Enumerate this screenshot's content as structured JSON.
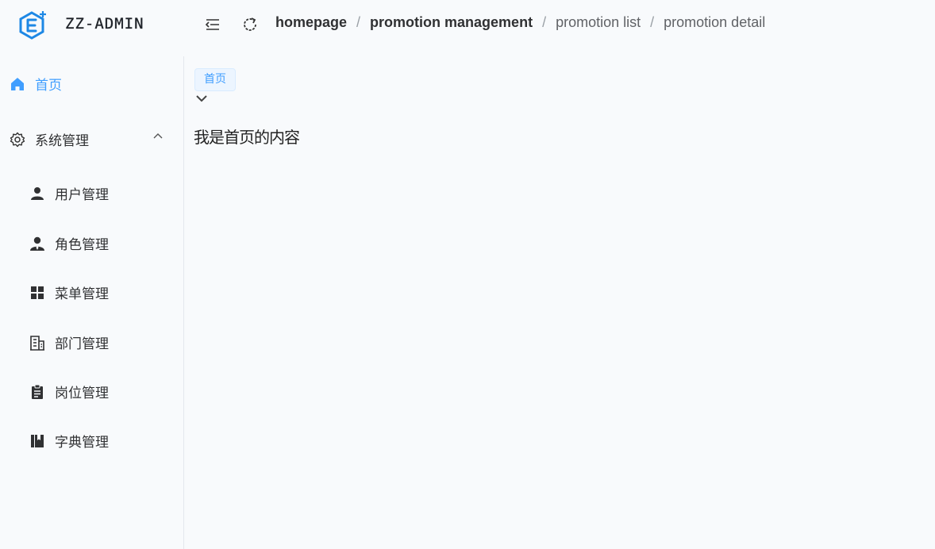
{
  "app": {
    "title": "ZZ-ADMIN",
    "logo_icon": "hexagon-e-plus-logo",
    "accent_color": "#409eff"
  },
  "header": {
    "collapse_icon": "menu-fold-icon",
    "refresh_icon": "refresh-icon",
    "breadcrumb": [
      "homepage",
      "promotion management",
      "promotion list",
      "promotion detail"
    ],
    "separator": "/"
  },
  "sidebar": {
    "home": {
      "label": "首页",
      "icon": "home-icon",
      "active": true
    },
    "system": {
      "label": "系统管理",
      "icon": "gear-icon",
      "expanded": true,
      "children": [
        {
          "label": "用户管理",
          "icon": "user-icon"
        },
        {
          "label": "角色管理",
          "icon": "role-icon"
        },
        {
          "label": "菜单管理",
          "icon": "grid-icon"
        },
        {
          "label": "部门管理",
          "icon": "building-icon"
        },
        {
          "label": "岗位管理",
          "icon": "clipboard-icon"
        },
        {
          "label": "字典管理",
          "icon": "book-icon"
        }
      ]
    }
  },
  "tabs": {
    "items": [
      {
        "label": "首页"
      }
    ]
  },
  "main": {
    "content_text": "我是首页的内容"
  }
}
